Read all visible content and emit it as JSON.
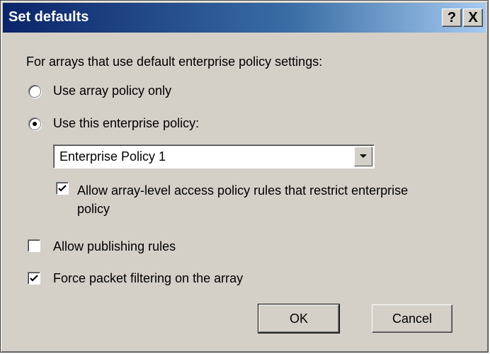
{
  "window": {
    "title": "Set defaults",
    "help_label": "?",
    "close_label": "X"
  },
  "form": {
    "intro": "For arrays that use default enterprise policy settings:",
    "radio_array_policy": {
      "label": "Use array policy only",
      "selected": false
    },
    "radio_enterprise_policy": {
      "label": "Use this enterprise policy:",
      "selected": true
    },
    "policy_select": {
      "value": "Enterprise Policy 1"
    },
    "allow_array_rules": {
      "label_line1": "Allow array-level access policy rules that restrict enterprise",
      "label_line2": "policy",
      "checked": true
    },
    "allow_publishing": {
      "label": "Allow publishing rules",
      "checked": false
    },
    "force_packet_filtering": {
      "label": "Force packet filtering on the array",
      "checked": true
    }
  },
  "buttons": {
    "ok": "OK",
    "cancel": "Cancel"
  }
}
